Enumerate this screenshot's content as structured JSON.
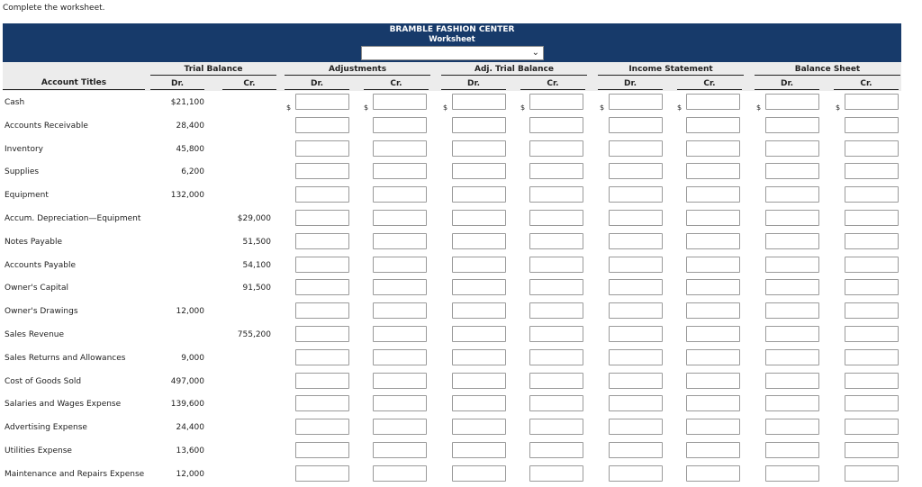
{
  "instruction": "Complete the worksheet.",
  "header": {
    "company": "BRAMBLE FASHION CENTER",
    "subtitle": "Worksheet",
    "period_dropdown": {
      "selected": ""
    }
  },
  "columns": {
    "account_titles": "Account Titles",
    "groups": [
      "Trial Balance",
      "Adjustments",
      "Adj. Trial Balance",
      "Income Statement",
      "Balance Sheet"
    ],
    "dr": "Dr.",
    "cr": "Cr."
  },
  "currency_symbol": "$",
  "rows": [
    {
      "account": "Cash",
      "dr": "$21,100",
      "cr": ""
    },
    {
      "account": "Accounts Receivable",
      "dr": "28,400",
      "cr": ""
    },
    {
      "account": "Inventory",
      "dr": "45,800",
      "cr": ""
    },
    {
      "account": "Supplies",
      "dr": "6,200",
      "cr": ""
    },
    {
      "account": "Equipment",
      "dr": "132,000",
      "cr": ""
    },
    {
      "account": "Accum. Depreciation—Equipment",
      "dr": "",
      "cr": "$29,000"
    },
    {
      "account": "Notes Payable",
      "dr": "",
      "cr": "51,500"
    },
    {
      "account": "Accounts Payable",
      "dr": "",
      "cr": "54,100"
    },
    {
      "account": "Owner's Capital",
      "dr": "",
      "cr": "91,500"
    },
    {
      "account": "Owner's Drawings",
      "dr": "12,000",
      "cr": ""
    },
    {
      "account": "Sales Revenue",
      "dr": "",
      "cr": "755,200"
    },
    {
      "account": "Sales Returns and Allowances",
      "dr": "9,000",
      "cr": ""
    },
    {
      "account": "Cost of Goods Sold",
      "dr": "497,000",
      "cr": ""
    },
    {
      "account": "Salaries and Wages Expense",
      "dr": "139,600",
      "cr": ""
    },
    {
      "account": "Advertising Expense",
      "dr": "24,400",
      "cr": ""
    },
    {
      "account": "Utilities Expense",
      "dr": "13,600",
      "cr": ""
    },
    {
      "account": "Maintenance and Repairs Expense",
      "dr": "12,000",
      "cr": ""
    }
  ]
}
